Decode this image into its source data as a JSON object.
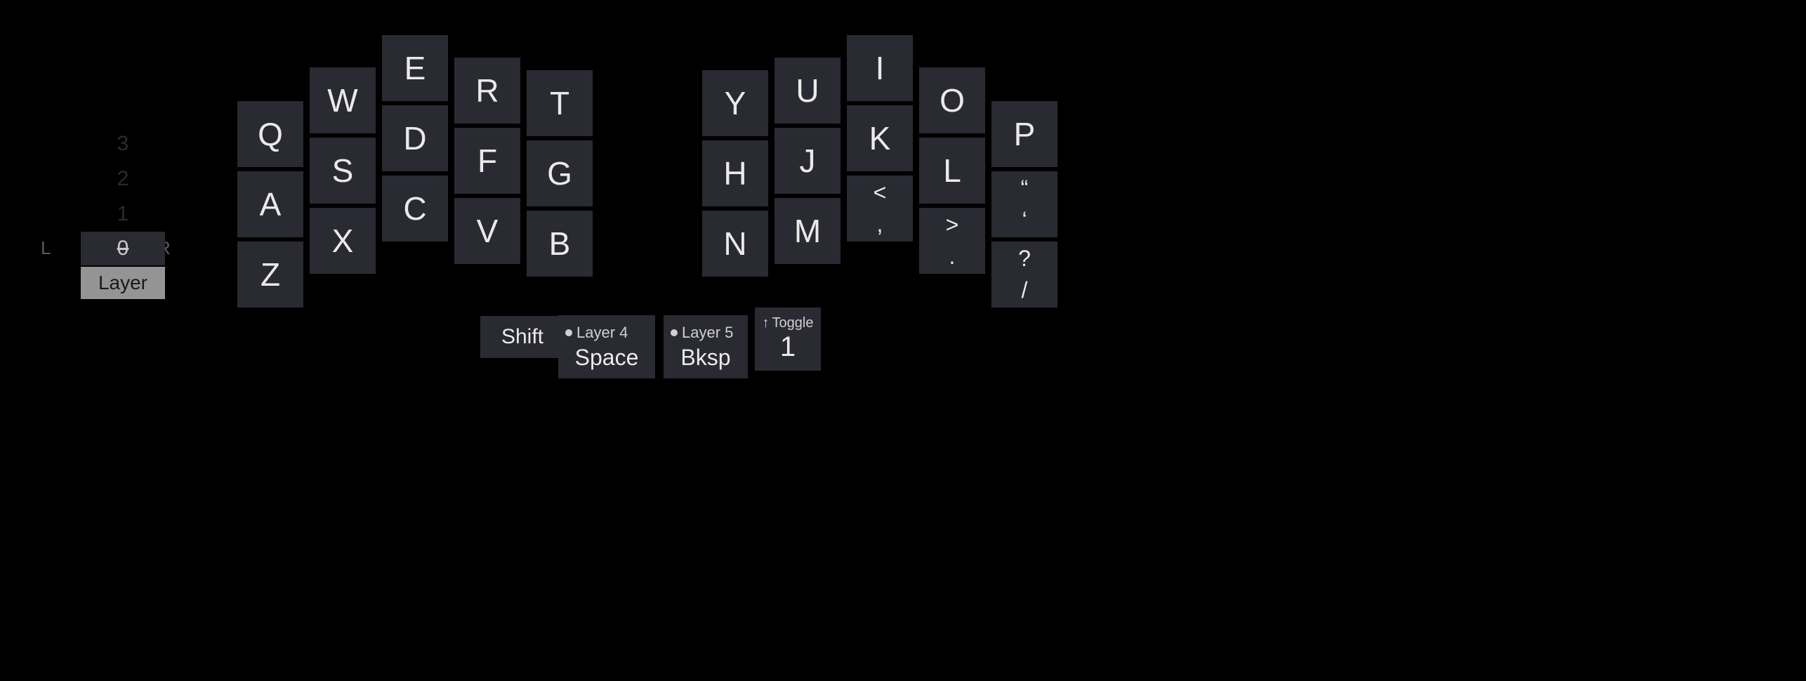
{
  "layers": {
    "numbers": [
      "3",
      "2",
      "1",
      "0"
    ],
    "active_index": 3,
    "label": "Layer",
    "side_left": "L",
    "side_right": "R"
  },
  "left": {
    "col0": [
      "Q",
      "A",
      "Z"
    ],
    "col1": [
      "W",
      "S",
      "X"
    ],
    "col2": [
      "E",
      "D",
      "C"
    ],
    "col3": [
      "R",
      "F",
      "V"
    ],
    "col4": [
      "T",
      "G",
      "B"
    ]
  },
  "right": {
    "col0": [
      "Y",
      "H",
      "N"
    ],
    "col1": [
      "U",
      "J",
      "M"
    ],
    "col2": [
      "I",
      "K"
    ],
    "col2_punct": {
      "top": "<",
      "bot": ","
    },
    "col3": [
      "O",
      "L"
    ],
    "col3_punct": {
      "top": ">",
      "bot": "."
    },
    "col4": [
      "P"
    ],
    "col4_quote": {
      "top": "“",
      "bot": "‘"
    },
    "col4_slash": {
      "top": "?",
      "bot": "/"
    }
  },
  "thumbs": {
    "shift": "Shift",
    "space": {
      "hint": "Layer 4",
      "main": "Space"
    },
    "bksp": {
      "hint": "Layer 5",
      "main": "Bksp"
    },
    "toggle": {
      "hint": "Toggle",
      "main": "1"
    }
  }
}
